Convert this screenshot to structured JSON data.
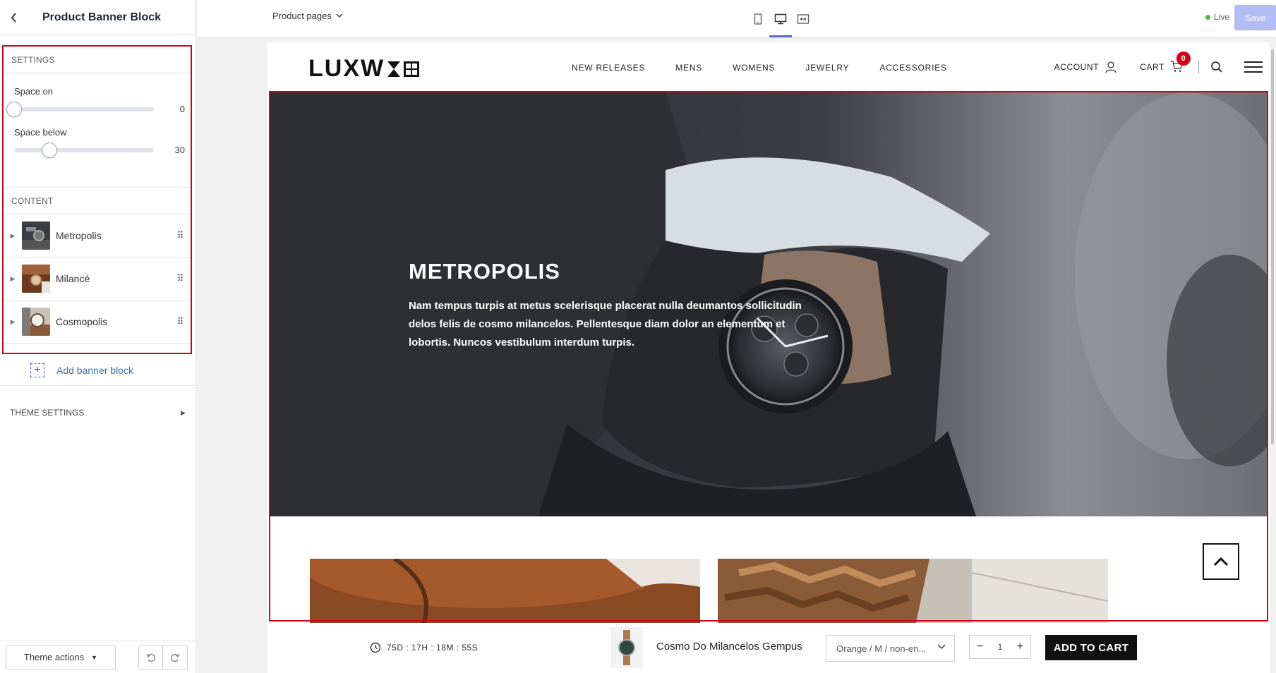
{
  "editor": {
    "title": "Product Banner Block",
    "settings_label": "SETTINGS",
    "space_on_label": "Space on",
    "space_on_value": "0",
    "space_on_fraction": 0.0,
    "space_below_label": "Space below",
    "space_below_value": "30",
    "space_below_fraction": 0.25,
    "content_label": "CONTENT",
    "content_items": [
      {
        "label": "Metropolis"
      },
      {
        "label": "Milancé"
      },
      {
        "label": "Cosmopolis"
      }
    ],
    "add_banner_label": "Add banner block",
    "theme_settings_label": "THEME SETTINGS",
    "theme_actions_label": "Theme actions"
  },
  "topbar": {
    "page_select": "Product pages",
    "live_label": "Live",
    "save_label": "Save"
  },
  "store": {
    "logo": "LUXW",
    "nav": [
      "NEW RELEASES",
      "MENS",
      "WOMENS",
      "JEWELRY",
      "ACCESSORIES"
    ],
    "account_label": "ACCOUNT",
    "cart_label": "CART",
    "cart_count": "0"
  },
  "hero": {
    "title": "METROPOLIS",
    "description": "Nam tempus turpis at metus scelerisque placerat nulla deumantos sollicitudin delos felis de cosmo milancelos. Pellentesque diam dolor an elementum et lobortis. Nuncos vestibulum interdum turpis."
  },
  "sticky": {
    "timer": "75D : 17H : 18M : 55S",
    "product_name": "Cosmo Do Milancelos Gempus",
    "variant": "Orange / M / non-en...",
    "quantity": "1",
    "add_to_cart": "ADD TO CART"
  },
  "colors": {
    "highlight": "#d0021b",
    "save_button": "#b3bcf5",
    "live_dot": "#50b83c",
    "active_device": "#5c6ac4"
  },
  "icons": [
    "back-arrow-icon",
    "drag-handle-icon",
    "add-block-icon",
    "undo-icon",
    "redo-icon",
    "mobile-icon",
    "desktop-icon",
    "fullscreen-icon",
    "user-icon",
    "cart-icon",
    "search-icon",
    "menu-icon",
    "clock-icon",
    "chevron-up-icon"
  ]
}
